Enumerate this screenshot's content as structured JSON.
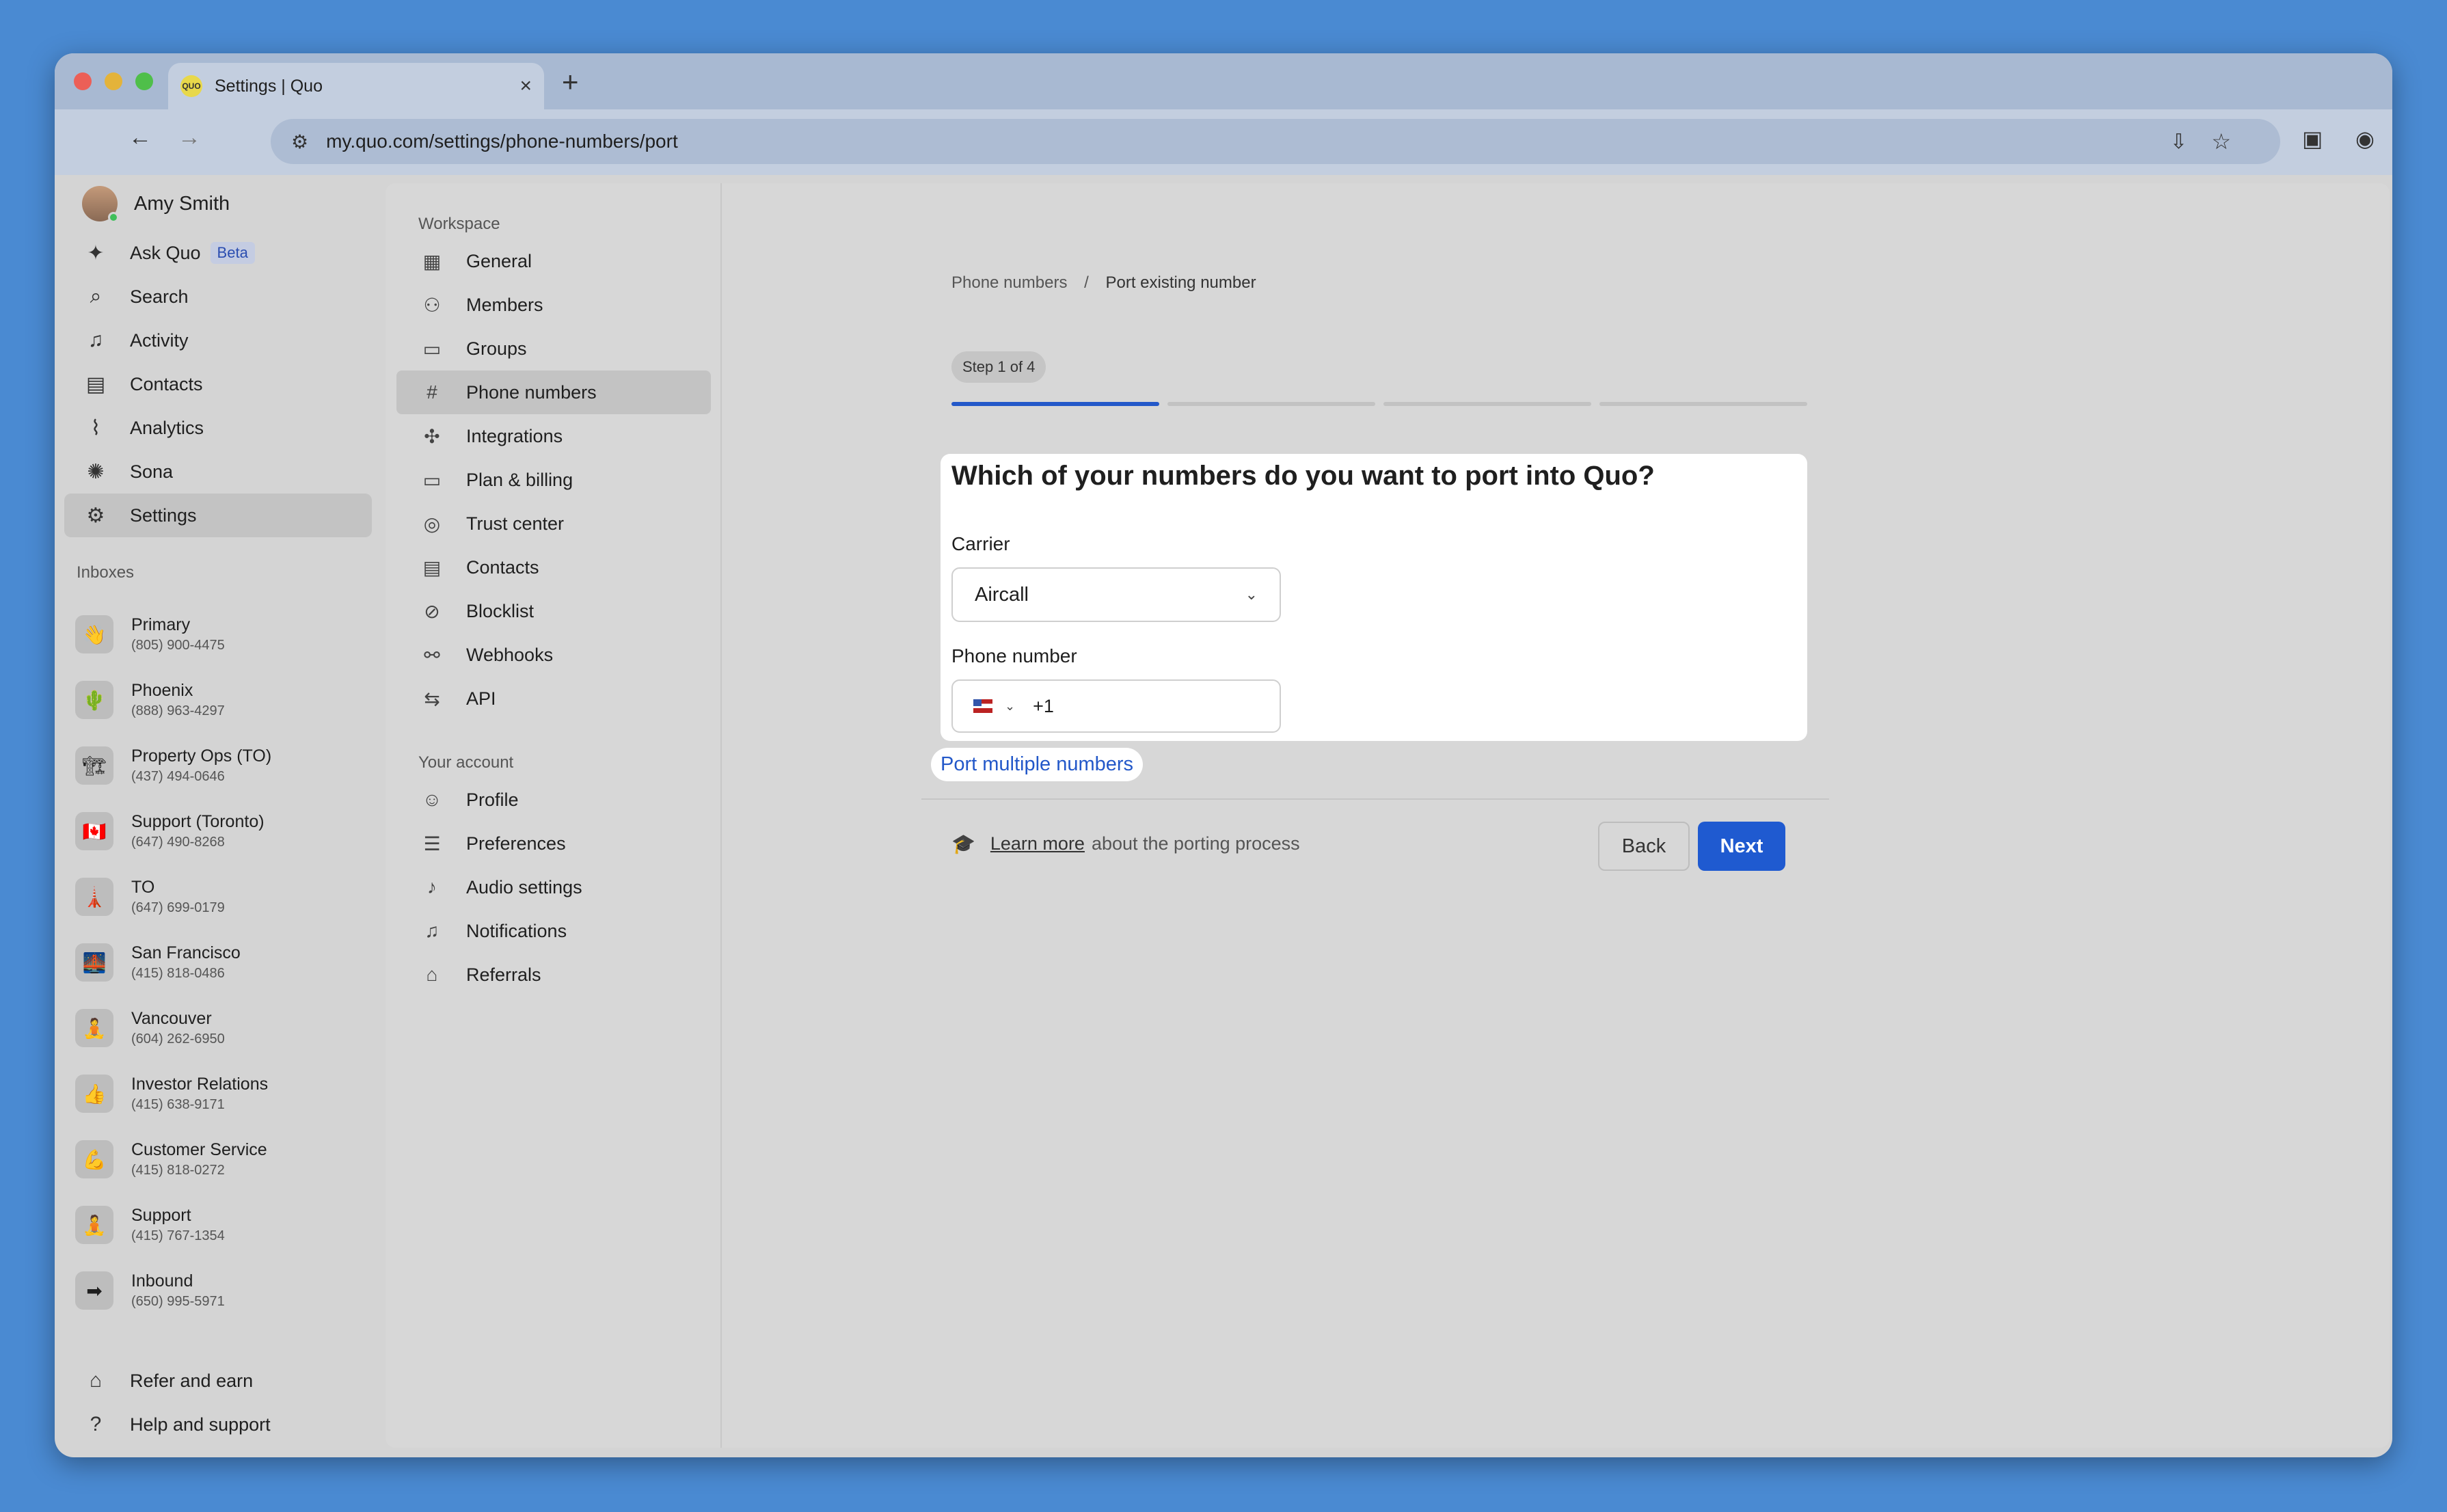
{
  "browser": {
    "tab_title": "Settings | Quo",
    "favicon_text": "QUO",
    "new_tab": "+",
    "close": "×",
    "url": "my.quo.com/settings/phone-numbers/port"
  },
  "sidebar": {
    "user_name": "Amy Smith",
    "beta_badge": "Beta",
    "nav": [
      {
        "label": "Ask Quo",
        "icon": "sparkle-icon",
        "glyph": "✦"
      },
      {
        "label": "Search",
        "icon": "search-icon",
        "glyph": "⌕"
      },
      {
        "label": "Activity",
        "icon": "bell-icon",
        "glyph": "♫"
      },
      {
        "label": "Contacts",
        "icon": "contacts-icon",
        "glyph": "▤"
      },
      {
        "label": "Analytics",
        "icon": "analytics-icon",
        "glyph": "⌇"
      },
      {
        "label": "Sona",
        "icon": "sona-icon",
        "glyph": "✺"
      },
      {
        "label": "Settings",
        "icon": "gear-icon",
        "glyph": "⚙"
      }
    ],
    "inboxes_label": "Inboxes",
    "inboxes": [
      {
        "name": "Primary",
        "phone": "(805) 900-4475",
        "emoji": "👋"
      },
      {
        "name": "Phoenix",
        "phone": "(888) 963-4297",
        "emoji": "🌵"
      },
      {
        "name": "Property Ops (TO)",
        "phone": "(437) 494-0646",
        "emoji": "🏗"
      },
      {
        "name": "Support (Toronto)",
        "phone": "(647) 490-8268",
        "emoji": "🇨🇦"
      },
      {
        "name": "TO",
        "phone": "(647) 699-0179",
        "emoji": "🗼"
      },
      {
        "name": "San Francisco",
        "phone": "(415) 818-0486",
        "emoji": "🌉"
      },
      {
        "name": "Vancouver",
        "phone": "(604) 262-6950",
        "emoji": "🧘"
      },
      {
        "name": "Investor Relations",
        "phone": "(415) 638-9171",
        "emoji": "👍"
      },
      {
        "name": "Customer Service",
        "phone": "(415) 818-0272",
        "emoji": "💪"
      },
      {
        "name": "Support",
        "phone": "(415) 767-1354",
        "emoji": "🧘"
      },
      {
        "name": "Inbound",
        "phone": "(650) 995-5971",
        "emoji": "➡"
      }
    ],
    "refer": "Refer and earn",
    "help": "Help and support"
  },
  "settings_nav": {
    "workspace_label": "Workspace",
    "workspace": [
      {
        "label": "General",
        "glyph": "▦"
      },
      {
        "label": "Members",
        "glyph": "⚇"
      },
      {
        "label": "Groups",
        "glyph": "▭"
      },
      {
        "label": "Phone numbers",
        "glyph": "#"
      },
      {
        "label": "Integrations",
        "glyph": "✣"
      },
      {
        "label": "Plan & billing",
        "glyph": "▭"
      },
      {
        "label": "Trust center",
        "glyph": "◎"
      },
      {
        "label": "Contacts",
        "glyph": "▤"
      },
      {
        "label": "Blocklist",
        "glyph": "⊘"
      },
      {
        "label": "Webhooks",
        "glyph": "⚯"
      },
      {
        "label": "API",
        "glyph": "⇆"
      }
    ],
    "account_label": "Your account",
    "account": [
      {
        "label": "Profile",
        "glyph": "☺"
      },
      {
        "label": "Preferences",
        "glyph": "☰"
      },
      {
        "label": "Audio settings",
        "glyph": "♪"
      },
      {
        "label": "Notifications",
        "glyph": "♫"
      },
      {
        "label": "Referrals",
        "glyph": "⌂"
      }
    ]
  },
  "main": {
    "breadcrumb_parent": "Phone numbers",
    "breadcrumb_sep": "/",
    "breadcrumb_current": "Port existing number",
    "step_label": "Step 1 of 4",
    "steps_total": 4,
    "steps_done": 1,
    "question": "Which of your numbers do you want to port into Quo?",
    "carrier_label": "Carrier",
    "carrier_value": "Aircall",
    "phone_label": "Phone number",
    "country_code": "+1",
    "port_multiple": "Port multiple numbers",
    "learn_more": "Learn more",
    "learn_rest": "about the porting process",
    "back": "Back",
    "next": "Next",
    "accent": "#1f5ad0"
  }
}
